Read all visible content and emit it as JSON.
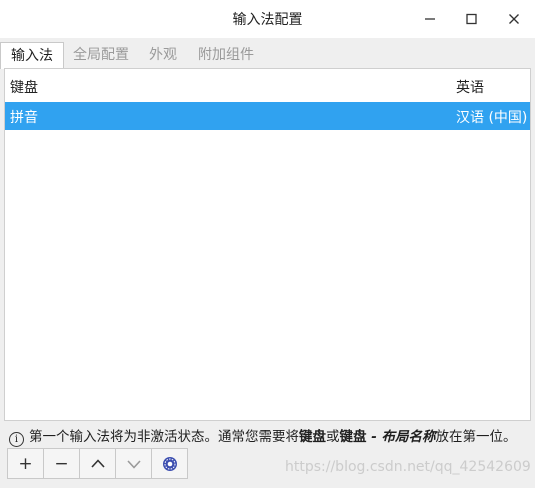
{
  "window": {
    "title": "输入法配置"
  },
  "tabs": [
    {
      "label": "输入法",
      "active": true
    },
    {
      "label": "全局配置",
      "active": false
    },
    {
      "label": "外观",
      "active": false
    },
    {
      "label": "附加组件",
      "active": false
    }
  ],
  "list": {
    "headers": [
      "键盘",
      "英语"
    ],
    "rows": [
      {
        "name": "拼音",
        "language": "汉语 (中国)",
        "selected": true
      }
    ]
  },
  "info": {
    "icon": "info-icon",
    "text1": "第一个输入法将为非激活状态。通常您需要将",
    "bold1": "键盘",
    "text2": "或",
    "bold2": "键盘",
    "italic": " - 布局名称",
    "text3": "放在第一位。"
  },
  "toolbar": {
    "add": "+",
    "remove": "−"
  },
  "watermark": "https://blog.csdn.net/qq_42542609",
  "colors": {
    "selection": "#30a2f0",
    "background": "#efefef"
  }
}
